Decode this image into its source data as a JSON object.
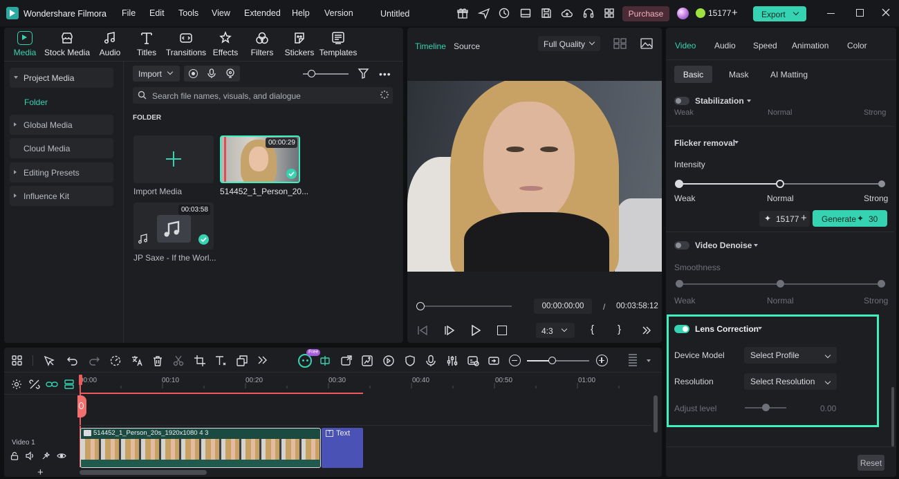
{
  "app": {
    "title": "Wondershare Filmora",
    "document": "Untitled"
  },
  "menu": [
    "File",
    "Edit",
    "Tools",
    "View",
    "Extended",
    "Help",
    "Version"
  ],
  "titlebar": {
    "purchase": "Purchase",
    "credits": "15177",
    "export": "Export"
  },
  "media_tabs": [
    {
      "label": "Media",
      "icon": "media-icon",
      "active": true
    },
    {
      "label": "Stock Media",
      "icon": "stock-media-icon"
    },
    {
      "label": "Audio",
      "icon": "music-note-icon"
    },
    {
      "label": "Titles",
      "icon": "titles-icon"
    },
    {
      "label": "Transitions",
      "icon": "transitions-icon"
    },
    {
      "label": "Effects",
      "icon": "effects-icon"
    },
    {
      "label": "Filters",
      "icon": "filters-icon"
    },
    {
      "label": "Stickers",
      "icon": "stickers-icon"
    },
    {
      "label": "Templates",
      "icon": "templates-icon"
    }
  ],
  "sidebar": {
    "items": [
      {
        "label": "Project Media",
        "expanded": true
      },
      {
        "label": "Folder",
        "active": true
      },
      {
        "label": "Global Media"
      },
      {
        "label": "Cloud Media"
      },
      {
        "label": "Editing Presets"
      },
      {
        "label": "Influence Kit"
      }
    ]
  },
  "media": {
    "import_label": "Import",
    "search_placeholder": "Search file names, visuals, and dialogue",
    "folder_label": "FOLDER",
    "import_media": "Import Media",
    "clip1": {
      "name": "514452_1_Person_20...",
      "duration": "00:00:29"
    },
    "clip2": {
      "name": "JP Saxe - If the Worl...",
      "duration": "00:03:58"
    }
  },
  "player": {
    "tabs": [
      "Timeline",
      "Source"
    ],
    "quality": "Full Quality",
    "current_time": "00:00:00:00",
    "separator": "/",
    "total_time": "00:03:58:12",
    "ratio": "4:3",
    "bracket_in": "{",
    "bracket_out": "}"
  },
  "props": {
    "tabs": [
      "Video",
      "Audio",
      "Speed",
      "Animation",
      "Color"
    ],
    "subtabs": [
      "Basic",
      "Mask",
      "AI Matting"
    ],
    "stabilization": {
      "label": "Stabilization",
      "weak": "Weak",
      "normal": "Normal",
      "strong": "Strong"
    },
    "flicker": {
      "label": "Flicker removal",
      "intensity": "Intensity",
      "weak": "Weak",
      "normal": "Normal",
      "strong": "Strong",
      "level": 0.5,
      "credits": "15177",
      "generate": "Generate",
      "generate_cost": "30"
    },
    "denoise": {
      "label": "Video Denoise",
      "smoothness": "Smoothness",
      "weak": "Weak",
      "normal": "Normal",
      "strong": "Strong"
    },
    "lens": {
      "label": "Lens Correction",
      "device_model": "Device Model",
      "device_value": "Select Profile",
      "resolution": "Resolution",
      "resolution_value": "Select Resolution",
      "adjust": "Adjust level",
      "adjust_value": "0.00"
    },
    "reset": "Reset"
  },
  "timeline": {
    "ticks": [
      "00:00",
      "00:10",
      "00:20",
      "00:30",
      "00:40",
      "00:50",
      "01:00"
    ],
    "track_label": "Video 1",
    "clip_label": "514452_1_Person_20s_1920x1080 4 3",
    "text_clip": "Text",
    "free_badge": "Free"
  },
  "colors": {
    "accent": "#35d3b1",
    "purchase": "#4b2b35",
    "highlight": "#3ef0c0",
    "playhead": "#f05a5a",
    "text_clip": "#4a52b5"
  }
}
